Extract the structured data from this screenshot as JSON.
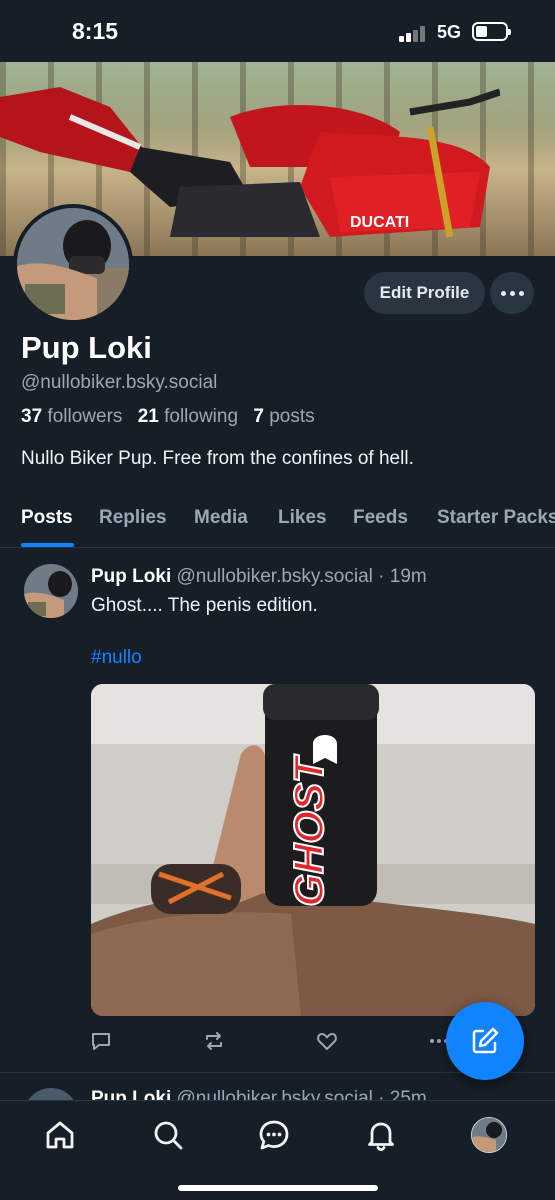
{
  "status_bar": {
    "time": "8:15",
    "network": "5G"
  },
  "profile": {
    "display_name": "Pup Loki",
    "handle": "@nullobiker.bsky.social",
    "followers_count": "37",
    "followers_label": "followers",
    "following_count": "21",
    "following_label": "following",
    "posts_count": "7",
    "posts_label": "posts",
    "bio": "Nullo Biker Pup. Free from the confines of hell.",
    "edit_button": "Edit Profile"
  },
  "tabs": [
    {
      "label": "Posts",
      "active": true
    },
    {
      "label": "Replies"
    },
    {
      "label": "Media"
    },
    {
      "label": "Likes"
    },
    {
      "label": "Feeds"
    },
    {
      "label": "Starter Packs"
    }
  ],
  "post": {
    "author": "Pup Loki",
    "handle": "@nullobiker.bsky.social",
    "time": "· 19m",
    "text": "Ghost.... The penis edition.",
    "hashtag": "#nullo",
    "image_brand_text": "GHOST"
  },
  "next_post": {
    "author": "Pup Loki",
    "handle": "@nullobiker.bsky.social",
    "time": "· 25m"
  },
  "icons": {
    "reply": "reply-icon",
    "repost": "repost-icon",
    "like": "heart-icon",
    "more": "more-icon",
    "compose": "compose-icon",
    "nav": [
      "home-icon",
      "search-icon",
      "chat-icon",
      "bell-icon",
      "profile-avatar"
    ]
  },
  "colors": {
    "background": "#161e27",
    "accent": "#1083fe",
    "muted": "#9aa8b6"
  }
}
